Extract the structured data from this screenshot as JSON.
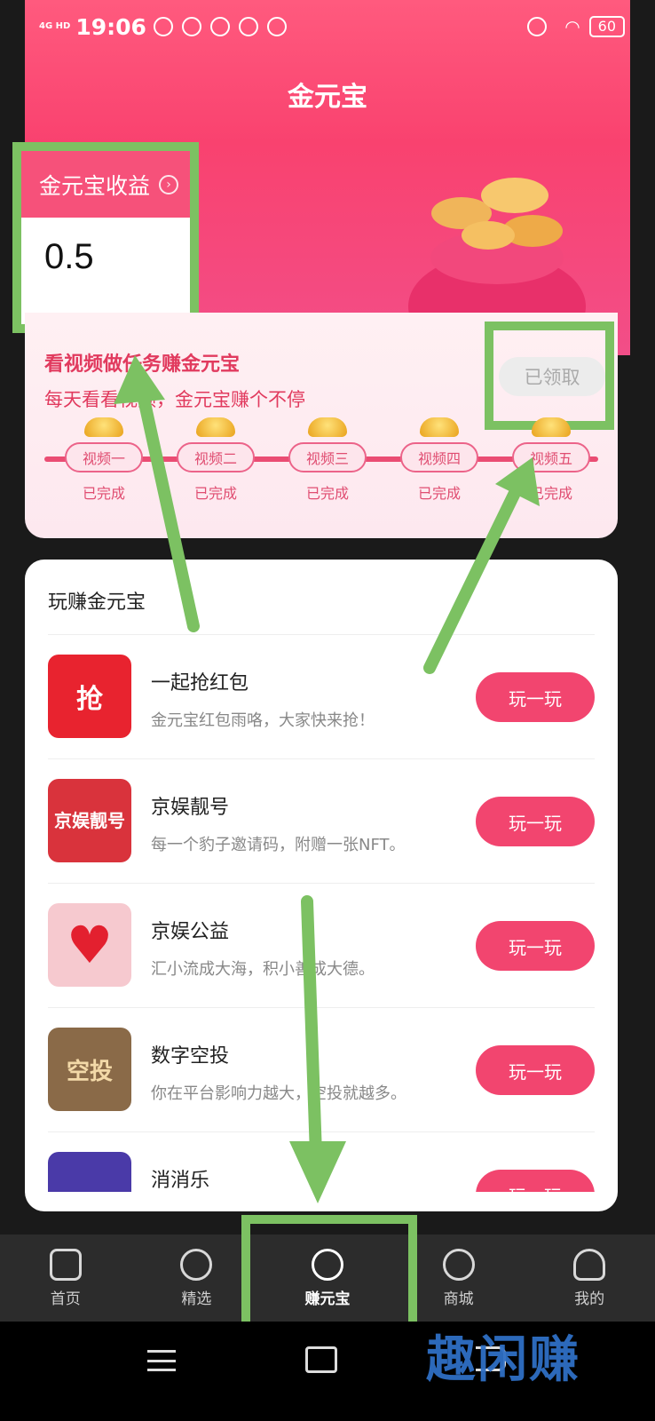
{
  "status_bar": {
    "network": "4G HD",
    "time": "19:06",
    "battery": "60"
  },
  "header": {
    "title": "金元宝"
  },
  "earnings": {
    "label": "金元宝收益",
    "value": "0.5"
  },
  "task_card": {
    "title": "看视频做任务赚金元宝",
    "subtitle": "每天看看视频，金元宝赚个不停",
    "claim_button": "已领取",
    "steps": [
      {
        "label": "视频一",
        "status": "已完成"
      },
      {
        "label": "视频二",
        "status": "已完成"
      },
      {
        "label": "视频三",
        "status": "已完成"
      },
      {
        "label": "视频四",
        "status": "已完成"
      },
      {
        "label": "视频五",
        "status": "已完成"
      }
    ]
  },
  "games": {
    "section_title": "玩赚金元宝",
    "play_label": "玩一玩",
    "items": [
      {
        "name": "一起抢红包",
        "desc": "金元宝红包雨咯，大家快来抢！",
        "icon_text": "抢",
        "icon": "red-envelope-icon",
        "color": "#e8232f"
      },
      {
        "name": "京娱靓号",
        "desc": "每一个豹子邀请码，附赠一张NFT。",
        "icon_text": "京娱靓号",
        "icon": "pretty-number-icon",
        "color": "#d9333c"
      },
      {
        "name": "京娱公益",
        "desc": "汇小流成大海，积小善成大德。",
        "icon_text": "♥",
        "icon": "heart-icon",
        "color": "#f6c9cf"
      },
      {
        "name": "数字空投",
        "desc": "你在平台影响力越大，空投就越多。",
        "icon_text": "空投",
        "icon": "airdrop-icon",
        "color": "#8a6a48"
      },
      {
        "name": "消消乐",
        "desc": "",
        "icon_text": "",
        "icon": "match-game-icon",
        "color": "#4a3aa8"
      }
    ]
  },
  "bottom_nav": {
    "items": [
      {
        "label": "首页",
        "icon": "home-icon"
      },
      {
        "label": "精选",
        "icon": "play-circle-icon"
      },
      {
        "label": "赚元宝",
        "icon": "earn-icon"
      },
      {
        "label": "商城",
        "icon": "mall-icon"
      },
      {
        "label": "我的",
        "icon": "profile-icon"
      }
    ],
    "active_index": 2
  },
  "watermark": "趣闲赚",
  "colors": {
    "primary": "#f2456f",
    "highlight": "#7cc162"
  }
}
